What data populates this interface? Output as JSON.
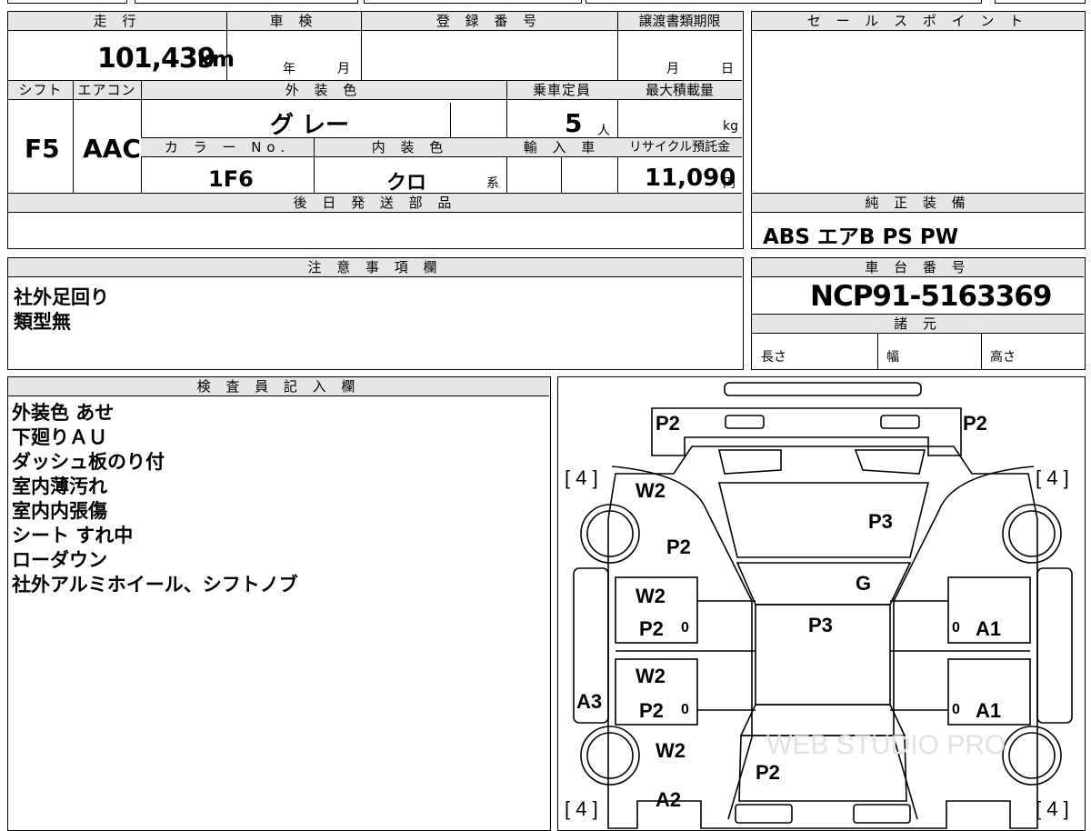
{
  "left_block": {
    "mileage": {
      "header": "走 行",
      "value": "101,439",
      "unit": "km"
    },
    "inspection": {
      "header": "車 検",
      "year_unit": "年",
      "month_unit": "月"
    },
    "registration": {
      "header": "登 録 番 号"
    },
    "transfer_deadline": {
      "header": "譲渡書類期限",
      "month_unit": "月",
      "day_unit": "日"
    },
    "shift": {
      "header": "シフト",
      "value": "F5"
    },
    "aircon": {
      "header": "エアコン",
      "value": "AAC"
    },
    "exterior_color": {
      "header": "外 装 色",
      "value": "グ レー"
    },
    "capacity": {
      "header": "乗車定員",
      "value": "5",
      "unit": "人"
    },
    "max_load": {
      "header": "最大積載量",
      "unit": "kg"
    },
    "color_no": {
      "header": "カ ラ ー No.",
      "value": "1F6"
    },
    "interior_color": {
      "header": "内 装 色",
      "value": "クロ",
      "suffix": "系"
    },
    "import": {
      "header": "輸 入 車"
    },
    "recycle": {
      "header": "リサイクル預託金",
      "value": "11,090",
      "unit": "円"
    },
    "later_parts": {
      "header": "後 日 発 送 部 品"
    }
  },
  "sales_point": {
    "header": "セ ー ル ス ポ イ ン ト"
  },
  "standard_equipment": {
    "header": "純 正 装 備",
    "value": "ABS エアB PS PW"
  },
  "notes": {
    "header": "注 意 事 項 欄",
    "lines": [
      "社外足回り",
      "類型無"
    ]
  },
  "chassis": {
    "header": "車 台 番 号",
    "value": "NCP91-5163369"
  },
  "specs": {
    "header": "諸 元",
    "length": "長さ",
    "width": "幅",
    "height": "高さ"
  },
  "inspector": {
    "header": "検 査 員 記 入 欄",
    "lines": [
      "外装色 あせ",
      "下廻りＡＵ",
      "ダッシュ板のり付",
      "室内薄汚れ",
      "室内内張傷",
      "シート すれ中",
      "ローダウン",
      "社外アルミホイール、シフトノブ"
    ]
  },
  "diagram": {
    "tire_tl": "[ 4 ]",
    "tire_tr": "[ 4 ]",
    "tire_bl": "[ 4 ]",
    "tire_br": "[ 4 ]",
    "codes": {
      "p2_tl": "P2",
      "p2_tr": "P2",
      "w2_fender_l": "W2",
      "p2_fender_l": "P2",
      "p3_hood": "P3",
      "g_windshield": "G",
      "w2_door_fl": "W2",
      "p2_door_fl": "P2",
      "p3_roof": "P3",
      "a1_door_fr": "A1",
      "w2_door_rl": "W2",
      "p2_door_rl": "P2",
      "a1_door_rr": "A1",
      "a3_sill_l": "A3",
      "w2_quarter_l": "W2",
      "p2_trunk": "P2",
      "a2_rear_l": "A2",
      "zero_fl": "0",
      "zero_rl": "0",
      "zero_fr": "0",
      "zero_rr": "0"
    },
    "watermark": "WEB STUDIO PRO"
  }
}
